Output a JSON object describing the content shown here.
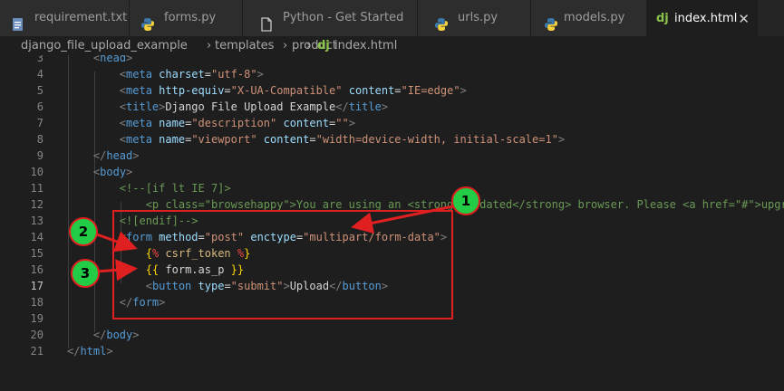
{
  "tabs": [
    {
      "label": "requirement.txt",
      "icon": "file-lines-icon"
    },
    {
      "label": "forms.py",
      "icon": "python-icon"
    },
    {
      "label": "Python - Get Started",
      "icon": "document-icon"
    },
    {
      "label": "urls.py",
      "icon": "python-icon"
    },
    {
      "label": "models.py",
      "icon": "python-icon"
    },
    {
      "label": "index.html",
      "icon": "django-icon",
      "active": true,
      "close": "✕"
    }
  ],
  "breadcrumb": {
    "items": [
      "django_file_upload_example",
      "templates",
      "product",
      "index.html"
    ],
    "separator": "›",
    "file_icon_label": "dj"
  },
  "tab_icon_label": "dj",
  "lines": [
    {
      "num": "3",
      "text": "    <head>"
    },
    {
      "num": "4",
      "text": "        <meta charset=\"utf-8\">"
    },
    {
      "num": "5",
      "text": "        <meta http-equiv=\"X-UA-Compatible\" content=\"IE=edge\">"
    },
    {
      "num": "6",
      "text": "        <title>Django File Upload Example</title>"
    },
    {
      "num": "7",
      "text": "        <meta name=\"description\" content=\"\">"
    },
    {
      "num": "8",
      "text": "        <meta name=\"viewport\" content=\"width=device-width, initial-scale=1\">"
    },
    {
      "num": "9",
      "text": "    </head>"
    },
    {
      "num": "10",
      "text": "    <body>"
    },
    {
      "num": "11",
      "text": "        <!--[if lt IE 7]>"
    },
    {
      "num": "12",
      "text": "            <p class=\"browsehappy\">You are using an <strong>outdated</strong> browser. Please <a href=\"#\">upgr"
    },
    {
      "num": "13",
      "text": "        <![endif]-->"
    },
    {
      "num": "14",
      "text": "        <form method=\"post\" enctype=\"multipart/form-data\">"
    },
    {
      "num": "15",
      "text": "            {% csrf_token %}"
    },
    {
      "num": "16",
      "text": "            {{ form.as_p }}"
    },
    {
      "num": "17",
      "text": "            <button type=\"submit\">Upload</button>"
    },
    {
      "num": "18",
      "text": "        </form>"
    },
    {
      "num": "19",
      "text": ""
    },
    {
      "num": "20",
      "text": "    </body>"
    },
    {
      "num": "21",
      "text": "</html>"
    }
  ],
  "current_line": "17",
  "annotations": [
    {
      "label": "1",
      "color": "#22cc44"
    },
    {
      "label": "2",
      "color": "#22cc44"
    },
    {
      "label": "3",
      "color": "#22cc44"
    }
  ],
  "annotation_color": "#e02020"
}
